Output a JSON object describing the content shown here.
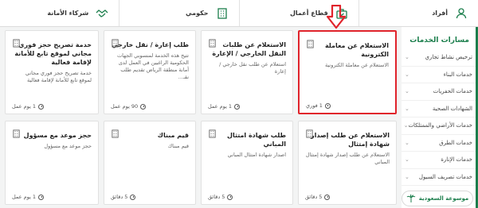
{
  "topbar": {
    "tabs": [
      {
        "label": "أفراد",
        "icon": "person-icon"
      },
      {
        "label": "قطاع أعمال",
        "icon": "briefcase-icon"
      },
      {
        "label": "حكومي",
        "icon": "building-icon"
      },
      {
        "label": "شركاء الأمانة",
        "icon": "handshake-icon"
      }
    ]
  },
  "sidebar": {
    "title": "مسارات الخدمات",
    "items": [
      "ترخيص نشاط تجاري",
      "خدمات البناء",
      "خدمات الحفريات",
      "الشهادات الصحية",
      "خدمات الأراضي والممتلكات",
      "خدمات الطرق",
      "خدمات الإنارة",
      "خدمات تصريف السيول"
    ]
  },
  "cards": {
    "c1": {
      "title": "الاستعلام عن معاملة الكترونية",
      "desc": "الاستعلام عن معاملة الكترونية",
      "duration": "1 فوري"
    },
    "c2": {
      "title": "الاستعلام عن طلبات النقل الخارجي / الإعارة",
      "desc": "استعلام عن طلب نقل خارجي / إعارة",
      "duration": "1 يوم عمل"
    },
    "c3": {
      "title": "طلب إعارة / نقل خارجي",
      "desc": "تتيح هذه الخدمة لمنسوبي الجهات الحكومية الراغبين في العمل لدى أمانة منطقة الرياض تقديم طلب نقـ...",
      "duration": "90 يوم عمل"
    },
    "c4": {
      "title": "خدمة تصريح حجز فوري مجاني لموقع تابع للأمانة لإقامة فعالية",
      "desc": "خدمة تصريح حجز فوري مجاني لموقع تابع للأمانة لإقامة فعالية",
      "duration": "1 يوم عمل"
    },
    "c5": {
      "title": "الاستعلام عن طلب إصدار شهادة إمتثال",
      "desc": "الاستعلام عن طلب إصدار شهادة إمتثال المباني",
      "duration": "5 دقائق"
    },
    "c6": {
      "title": "طلب شهادة امتثال المباني",
      "desc": "اصدار شهادة امتثال المباني",
      "duration": "5 دقائق"
    },
    "c7": {
      "title": "قيم مبناك",
      "desc": "قيم مبناك",
      "duration": "5 دقائق"
    },
    "c8": {
      "title": "حجز موعد مع مسؤول",
      "desc": "حجز موعد مع مسؤول",
      "duration": "1 يوم عمل"
    }
  },
  "logo": {
    "text": "موسوعة السعودية"
  },
  "colors": {
    "accent": "#1b7e4c",
    "highlight": "#e0232b"
  }
}
